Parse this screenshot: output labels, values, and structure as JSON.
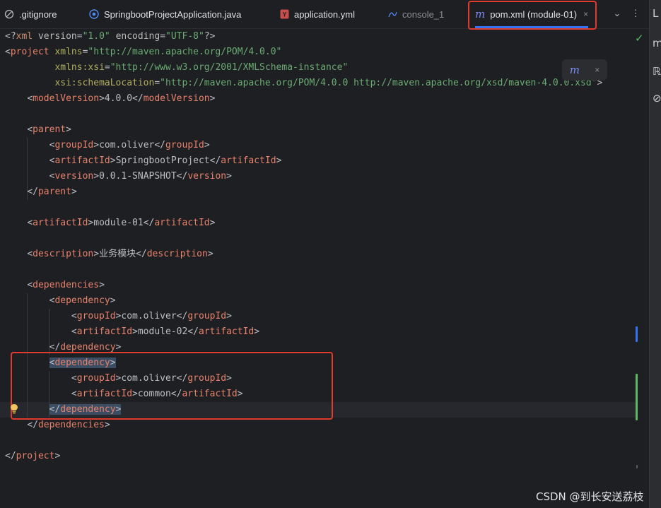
{
  "tabs": [
    {
      "label": ".gitignore",
      "icon": "ban-icon",
      "state": "normal"
    },
    {
      "label": "SpringbootProjectApplication.java",
      "icon": "java-class-icon",
      "state": "normal"
    },
    {
      "label": "application.yml",
      "icon": "yaml-file-icon",
      "state": "normal"
    },
    {
      "label": "console_1",
      "icon": "database-console-icon",
      "state": "dim"
    },
    {
      "label": "pom.xml (module-01)",
      "icon": "maven-icon",
      "state": "active"
    }
  ],
  "tab_actions": {
    "more_tabs": "⌄",
    "menu": "⋮",
    "close": "×"
  },
  "maven_popup": {
    "icon": "m",
    "close": "×"
  },
  "code_lines": [
    [
      [
        "br",
        "<?"
      ],
      [
        "tag",
        "xml "
      ],
      [
        "attr",
        "version"
      ],
      [
        "br",
        "="
      ],
      [
        "val",
        "\"1.0\" "
      ],
      [
        "attr",
        "encoding"
      ],
      [
        "br",
        "="
      ],
      [
        "val",
        "\"UTF-8\""
      ],
      [
        "br",
        "?>"
      ]
    ],
    [
      [
        "br",
        "<"
      ],
      [
        "tagname",
        "project "
      ],
      [
        "ns",
        "xmlns"
      ],
      [
        "br",
        "="
      ],
      [
        "val",
        "\"http://maven.apache.org/POM/4.0.0\""
      ]
    ],
    [
      [
        "text",
        "         "
      ],
      [
        "ns",
        "xmlns:xsi"
      ],
      [
        "br",
        "="
      ],
      [
        "val",
        "\"http://www.w3.org/2001/XMLSchema-instance\""
      ]
    ],
    [
      [
        "text",
        "         "
      ],
      [
        "ns",
        "xsi:schemaLocation"
      ],
      [
        "br",
        "="
      ],
      [
        "val",
        "\"http://maven.apache.org/POM/4.0.0 http://maven.apache.org/xsd/maven-4.0.0.xsd\""
      ],
      [
        "br",
        ">"
      ]
    ],
    [
      [
        "text",
        "    "
      ],
      [
        "br",
        "<"
      ],
      [
        "tagname",
        "modelVersion"
      ],
      [
        "br",
        ">"
      ],
      [
        "text",
        "4.0.0"
      ],
      [
        "br",
        "</"
      ],
      [
        "tagname",
        "modelVersion"
      ],
      [
        "br",
        ">"
      ]
    ],
    [],
    [
      [
        "text",
        "    "
      ],
      [
        "br",
        "<"
      ],
      [
        "tagname",
        "parent"
      ],
      [
        "br",
        ">"
      ]
    ],
    [
      [
        "text",
        "        "
      ],
      [
        "br",
        "<"
      ],
      [
        "tagname",
        "groupId"
      ],
      [
        "br",
        ">"
      ],
      [
        "text",
        "com.oliver"
      ],
      [
        "br",
        "</"
      ],
      [
        "tagname",
        "groupId"
      ],
      [
        "br",
        ">"
      ]
    ],
    [
      [
        "text",
        "        "
      ],
      [
        "br",
        "<"
      ],
      [
        "tagname",
        "artifactId"
      ],
      [
        "br",
        ">"
      ],
      [
        "text",
        "SpringbootProject"
      ],
      [
        "br",
        "</"
      ],
      [
        "tagname",
        "artifactId"
      ],
      [
        "br",
        ">"
      ]
    ],
    [
      [
        "text",
        "        "
      ],
      [
        "br",
        "<"
      ],
      [
        "tagname",
        "version"
      ],
      [
        "br",
        ">"
      ],
      [
        "text",
        "0.0.1-SNAPSHOT"
      ],
      [
        "br",
        "</"
      ],
      [
        "tagname",
        "version"
      ],
      [
        "br",
        ">"
      ]
    ],
    [
      [
        "text",
        "    "
      ],
      [
        "br",
        "</"
      ],
      [
        "tagname",
        "parent"
      ],
      [
        "br",
        ">"
      ]
    ],
    [],
    [
      [
        "text",
        "    "
      ],
      [
        "br",
        "<"
      ],
      [
        "tagname",
        "artifactId"
      ],
      [
        "br",
        ">"
      ],
      [
        "text",
        "module-01"
      ],
      [
        "br",
        "</"
      ],
      [
        "tagname",
        "artifactId"
      ],
      [
        "br",
        ">"
      ]
    ],
    [],
    [
      [
        "text",
        "    "
      ],
      [
        "br",
        "<"
      ],
      [
        "tagname",
        "description"
      ],
      [
        "br",
        ">"
      ],
      [
        "text",
        "业务模块"
      ],
      [
        "br",
        "</"
      ],
      [
        "tagname",
        "description"
      ],
      [
        "br",
        ">"
      ]
    ],
    [],
    [
      [
        "text",
        "    "
      ],
      [
        "br",
        "<"
      ],
      [
        "tagname",
        "dependencies"
      ],
      [
        "br",
        ">"
      ]
    ],
    [
      [
        "text",
        "        "
      ],
      [
        "br",
        "<"
      ],
      [
        "tagname",
        "dependency"
      ],
      [
        "br",
        ">"
      ]
    ],
    [
      [
        "text",
        "            "
      ],
      [
        "br",
        "<"
      ],
      [
        "tagname",
        "groupId"
      ],
      [
        "br",
        ">"
      ],
      [
        "text",
        "com.oliver"
      ],
      [
        "br",
        "</"
      ],
      [
        "tagname",
        "groupId"
      ],
      [
        "br",
        ">"
      ]
    ],
    [
      [
        "text",
        "            "
      ],
      [
        "br",
        "<"
      ],
      [
        "tagname",
        "artifactId"
      ],
      [
        "br",
        ">"
      ],
      [
        "text",
        "module-02"
      ],
      [
        "br",
        "</"
      ],
      [
        "tagname",
        "artifactId"
      ],
      [
        "br",
        ">"
      ]
    ],
    [
      [
        "text",
        "        "
      ],
      [
        "br",
        "</"
      ],
      [
        "tagname",
        "dependency"
      ],
      [
        "br",
        ">"
      ]
    ],
    [
      [
        "text",
        "        "
      ],
      [
        "sel",
        "<"
      ],
      [
        "seltag",
        "dependency"
      ],
      [
        "sel",
        ">"
      ]
    ],
    [
      [
        "text",
        "            "
      ],
      [
        "br",
        "<"
      ],
      [
        "tagname",
        "groupId"
      ],
      [
        "br",
        ">"
      ],
      [
        "text",
        "com.oliver"
      ],
      [
        "br",
        "</"
      ],
      [
        "tagname",
        "groupId"
      ],
      [
        "br",
        ">"
      ]
    ],
    [
      [
        "text",
        "            "
      ],
      [
        "br",
        "<"
      ],
      [
        "tagname",
        "artifactId"
      ],
      [
        "br",
        ">"
      ],
      [
        "text",
        "common"
      ],
      [
        "br",
        "</"
      ],
      [
        "tagname",
        "artifactId"
      ],
      [
        "br",
        ">"
      ]
    ],
    [
      [
        "text",
        "        "
      ],
      [
        "sel",
        "</"
      ],
      [
        "seltag",
        "dependency"
      ],
      [
        "sel",
        ">"
      ]
    ],
    [
      [
        "text",
        "    "
      ],
      [
        "br",
        "</"
      ],
      [
        "tagname",
        "dependencies"
      ],
      [
        "br",
        ">"
      ]
    ],
    [],
    [
      [
        "br",
        "</"
      ],
      [
        "tagname",
        "project"
      ],
      [
        "br",
        ">"
      ]
    ]
  ],
  "watermark": "CSDN @到长安送荔枝",
  "colors": {
    "background": "#1e1f22",
    "tag_name": "#e8826c",
    "attr_value": "#6aab73",
    "selection": "#3b4d63",
    "annotation_box": "#e13b2e",
    "accent": "#3574f0",
    "modified_gutter": "#5fb865",
    "changed_gutter": "#3574f0"
  }
}
